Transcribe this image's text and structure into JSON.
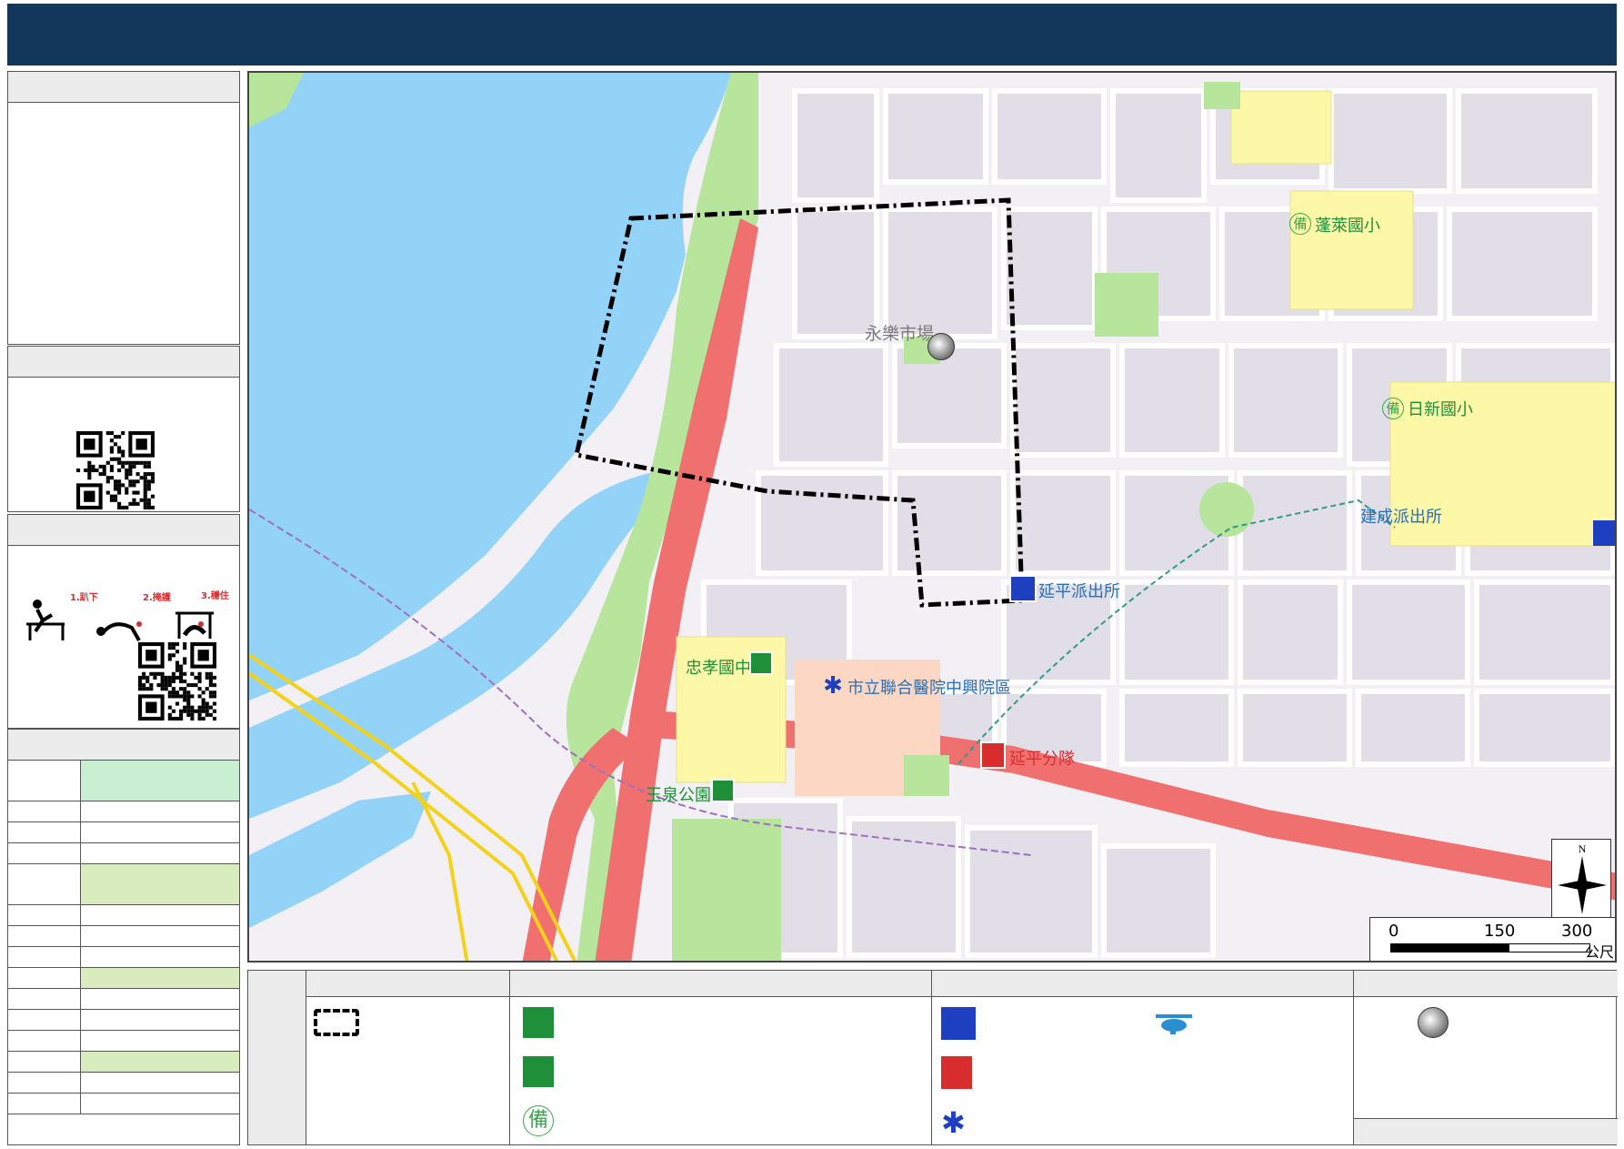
{
  "map": {
    "landmarks": {
      "yongle_market": "永樂市場",
      "penglai_school": "蓬萊國小",
      "rixin_school": "日新國小",
      "zhongxiao_school": "忠孝國中",
      "yuquan_park": "玉泉公園",
      "hospital": "市立聯合醫院中興院區",
      "yanping_police": "延平派出所",
      "jiancheng_police": "建成派出所",
      "yanping_fire": "延平分隊"
    },
    "backup_mark": "備",
    "scale": {
      "ticks": [
        "0",
        "150",
        "300"
      ],
      "unit": "公尺"
    },
    "compass_letter": "N"
  },
  "dance_steps": {
    "step1": "1.趴下",
    "step2": "2.掩護",
    "step3": "3.穩住"
  },
  "legend": {
    "backup_mark": "備"
  },
  "colors": {
    "header": "#12375a",
    "water": "#93d3f7",
    "park": "#b6e59b",
    "road_major": "#f07070",
    "school": "#fdf7a8",
    "hospital": "#fcd8c4",
    "police": "#1e3fbf",
    "fire": "#d82d2d",
    "emergency_green": "#1f8f3a",
    "row_green_light": "#c9efd2",
    "row_green": "#d8ecbe"
  }
}
